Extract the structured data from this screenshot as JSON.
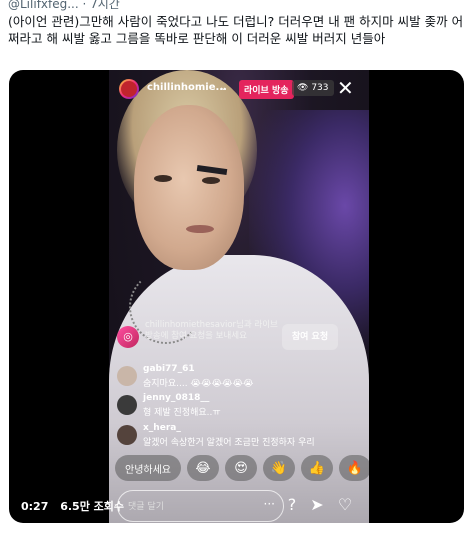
{
  "tweet": {
    "meta": "@Lilifxfeg... · 7시간",
    "text": "(아이언 관련)그만해 사람이 죽었다고 나도 더럽니? 더러우면 내 팬 하지마 씨발 좆까 어쩌라고 해 씨발 옳고 그름을 똑바로 판단해 이 더러운 씨발 버러지 년들아"
  },
  "live": {
    "username": "chillinhomie...",
    "live_badge": "라이브 방송",
    "viewers": "733",
    "request": {
      "text": "chillinhomiethesavior님과 라이브 방송에 참여 요청을 보내세요",
      "button": "참여 요청"
    },
    "comments": [
      {
        "user": "gabi77_61",
        "text": "숨지마요.... 😭😭😭😭😭😭"
      },
      {
        "user": "jenny_0818__",
        "text": "형 제발 진정해요..ㅠ"
      },
      {
        "user": "x_hera_",
        "text": "알겠어 속상한거 알겠어 조금만 진정하자 우리"
      }
    ],
    "quick_replies": [
      "안녕하세요",
      "😂",
      "😍",
      "👋",
      "👍",
      "🔥"
    ],
    "message_placeholder": "댓글 달기",
    "message_more": "···"
  },
  "video": {
    "time": "0:27",
    "views": "6.5만 조회수"
  },
  "colors": {
    "live": "#e4245d"
  }
}
